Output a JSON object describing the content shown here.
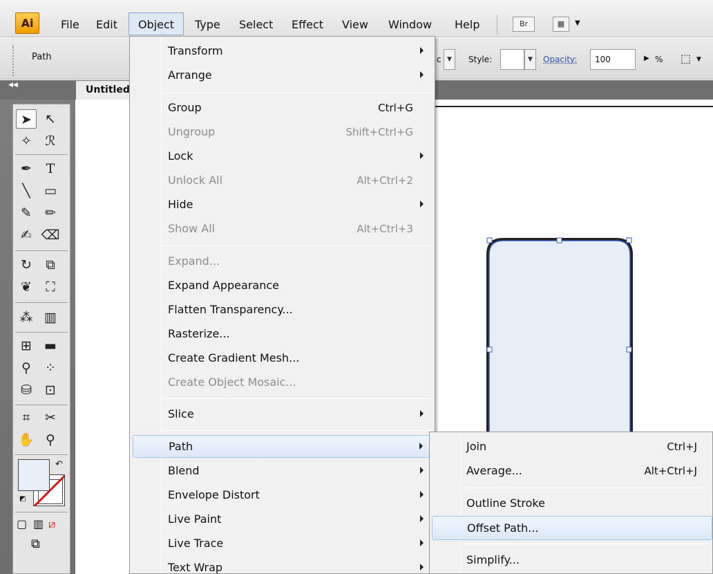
{
  "app": {
    "logo": "Ai",
    "menubar": [
      "File",
      "Edit",
      "Object",
      "Type",
      "Select",
      "Effect",
      "View",
      "Window",
      "Help"
    ],
    "bridge_button": "Br"
  },
  "control_bar": {
    "selection_type": "Path",
    "partial_field": "c",
    "style_label": "Style:",
    "style_value": "",
    "opacity_label": "Opacity:",
    "opacity_value": "100",
    "percent": "%"
  },
  "document": {
    "tab_title": "Untitled"
  },
  "object_menu": {
    "items": [
      {
        "label": "Transform",
        "shortcut": "",
        "submenu": true,
        "disabled": false
      },
      {
        "label": "Arrange",
        "shortcut": "",
        "submenu": true,
        "disabled": false
      },
      {
        "label": "Group",
        "shortcut": "Ctrl+G",
        "submenu": false,
        "disabled": false
      },
      {
        "label": "Ungroup",
        "shortcut": "Shift+Ctrl+G",
        "submenu": false,
        "disabled": true
      },
      {
        "label": "Lock",
        "shortcut": "",
        "submenu": true,
        "disabled": false
      },
      {
        "label": "Unlock All",
        "shortcut": "Alt+Ctrl+2",
        "submenu": false,
        "disabled": true
      },
      {
        "label": "Hide",
        "shortcut": "",
        "submenu": true,
        "disabled": false
      },
      {
        "label": "Show All",
        "shortcut": "Alt+Ctrl+3",
        "submenu": false,
        "disabled": true
      },
      {
        "label": "Expand...",
        "shortcut": "",
        "submenu": false,
        "disabled": true
      },
      {
        "label": "Expand Appearance",
        "shortcut": "",
        "submenu": false,
        "disabled": false
      },
      {
        "label": "Flatten Transparency...",
        "shortcut": "",
        "submenu": false,
        "disabled": false
      },
      {
        "label": "Rasterize...",
        "shortcut": "",
        "submenu": false,
        "disabled": false
      },
      {
        "label": "Create Gradient Mesh...",
        "shortcut": "",
        "submenu": false,
        "disabled": false
      },
      {
        "label": "Create Object Mosaic...",
        "shortcut": "",
        "submenu": false,
        "disabled": true
      },
      {
        "label": "Slice",
        "shortcut": "",
        "submenu": true,
        "disabled": false
      },
      {
        "label": "Path",
        "shortcut": "",
        "submenu": true,
        "disabled": false,
        "highlighted": true
      },
      {
        "label": "Blend",
        "shortcut": "",
        "submenu": true,
        "disabled": false
      },
      {
        "label": "Envelope Distort",
        "shortcut": "",
        "submenu": true,
        "disabled": false
      },
      {
        "label": "Live Paint",
        "shortcut": "",
        "submenu": true,
        "disabled": false
      },
      {
        "label": "Live Trace",
        "shortcut": "",
        "submenu": true,
        "disabled": false
      },
      {
        "label": "Text Wrap",
        "shortcut": "",
        "submenu": true,
        "disabled": false
      }
    ]
  },
  "path_submenu": {
    "items": [
      {
        "label": "Join",
        "shortcut": "Ctrl+J"
      },
      {
        "label": "Average...",
        "shortcut": "Alt+Ctrl+J"
      },
      {
        "label": "Outline Stroke",
        "shortcut": ""
      },
      {
        "label": "Offset Path...",
        "shortcut": "",
        "highlighted": true
      },
      {
        "label": "Simplify...",
        "shortcut": ""
      }
    ]
  },
  "tools": [
    "selection-tool",
    "direct-selection-tool",
    "magic-wand-tool",
    "lasso-tool",
    "pen-tool",
    "type-tool",
    "line-segment-tool",
    "rectangle-tool",
    "paintbrush-tool",
    "pencil-tool",
    "blob-brush-tool",
    "eraser-tool",
    "rotate-tool",
    "scale-tool",
    "warp-tool",
    "free-transform-tool",
    "symbol-sprayer-tool",
    "column-graph-tool",
    "mesh-tool",
    "gradient-tool",
    "eyedropper-tool",
    "blend-tool",
    "live-paint-bucket-tool",
    "live-paint-selection-tool",
    "artboard-tool",
    "slice-tool",
    "hand-tool",
    "zoom-tool"
  ],
  "colors": {
    "fill": "#e8eef7",
    "stroke": "none",
    "selection": "#3a55b8",
    "menu_highlight": "#dde9f8"
  }
}
